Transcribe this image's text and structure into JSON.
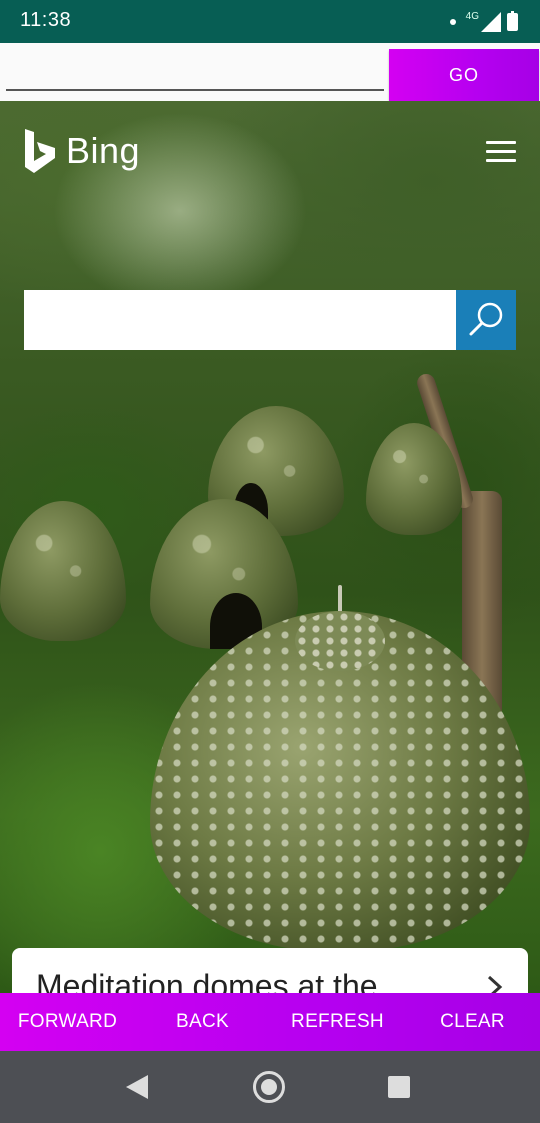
{
  "status_bar": {
    "time": "11:38",
    "network": "4G",
    "icons": [
      "notification-dot-icon",
      "signal-icon",
      "battery-icon"
    ]
  },
  "url_bar": {
    "value": "",
    "placeholder": "",
    "go_label": "GO"
  },
  "webpage": {
    "logo_text": "Bing",
    "search_value": "",
    "caption": "Meditation domes at the",
    "icons": [
      "bing-logo-icon",
      "hamburger-menu-icon",
      "search-icon",
      "chevron-right-icon"
    ]
  },
  "command_bar": {
    "forward": "FORWARD",
    "back": "BACK",
    "refresh": "REFRESH",
    "clear": "CLEAR"
  },
  "nav_bar": {
    "icons": [
      "back-triangle-icon",
      "home-circle-icon",
      "recent-apps-square-icon"
    ]
  },
  "colors": {
    "status_bar": "#075e54",
    "accent_purple": "#c400f0",
    "bing_search_blue": "#1a7fb8",
    "nav_bar": "#4d4f54"
  }
}
